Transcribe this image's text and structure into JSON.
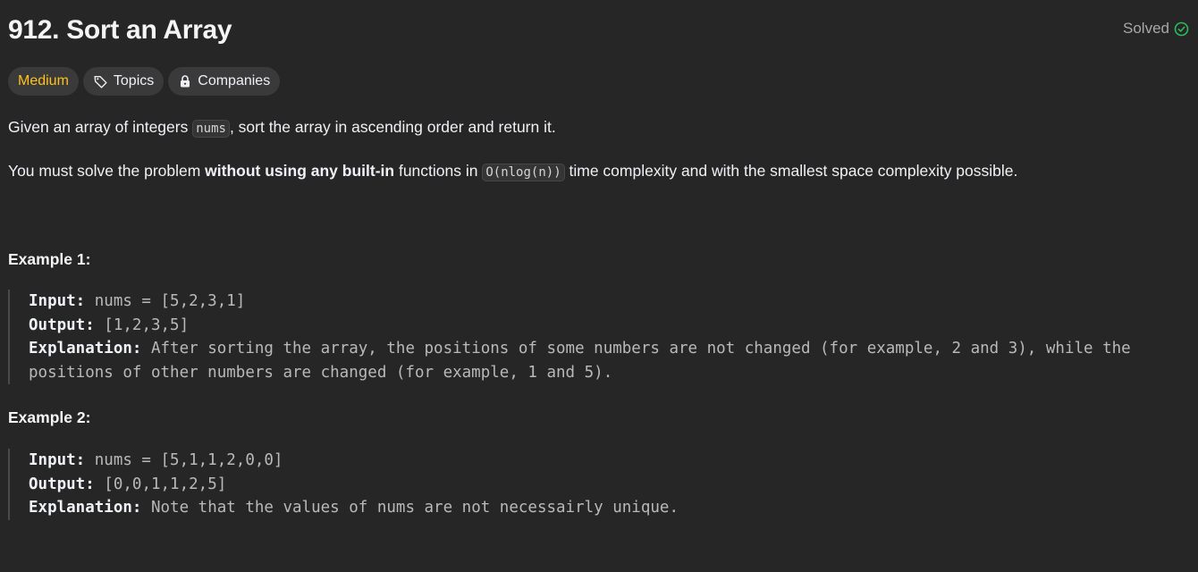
{
  "problem": {
    "title": "912. Sort an Array",
    "status": "Solved",
    "difficulty": "Medium",
    "topics_label": "Topics",
    "companies_label": "Companies"
  },
  "description": {
    "p1_before": "Given an array of integers ",
    "p1_code": "nums",
    "p1_after": ", sort the array in ascending order and return it.",
    "p2_before": "You must solve the problem ",
    "p2_bold": "without using any built-in",
    "p2_middle": " functions in ",
    "p2_code": "O(nlog(n))",
    "p2_after": " time complexity and with the smallest space complexity possible."
  },
  "examples": [
    {
      "heading": "Example 1:",
      "input_label": "Input:",
      "input_value": " nums = [5,2,3,1]",
      "output_label": "Output:",
      "output_value": " [1,2,3,5]",
      "explanation_label": "Explanation:",
      "explanation_value": " After sorting the array, the positions of some numbers are not changed (for example, 2 and 3), while the positions of other numbers are changed (for example, 1 and 5)."
    },
    {
      "heading": "Example 2:",
      "input_label": "Input:",
      "input_value": " nums = [5,1,1,2,0,0]",
      "output_label": "Output:",
      "output_value": " [0,0,1,1,2,5]",
      "explanation_label": "Explanation:",
      "explanation_value": " Note that the values of nums are not necessairly unique."
    }
  ],
  "icons": {
    "solved": "check-circle-icon",
    "topics": "tag-icon",
    "companies": "lock-icon"
  },
  "colors": {
    "background": "#262626",
    "medium": "#ffc01e",
    "solved_check": "#2cbb5d"
  }
}
